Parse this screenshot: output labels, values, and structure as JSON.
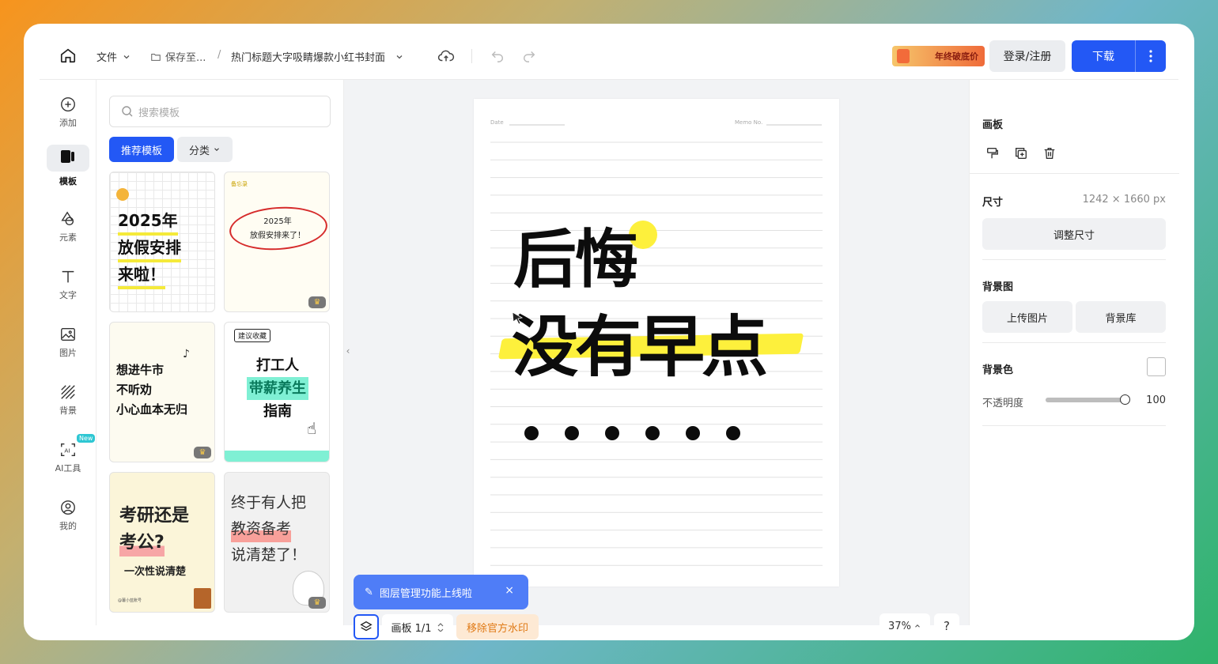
{
  "topbar": {
    "file_menu": "文件",
    "save_to": "保存至...",
    "breadcrumb_sep": "/",
    "doc_title": "热门标题大字吸睛爆款小红书封面",
    "promo_text": "年终破底价",
    "login": "登录/注册",
    "download": "下载"
  },
  "leftnav": {
    "items": [
      {
        "label": "添加",
        "icon": "plus-circle-icon"
      },
      {
        "label": "模板",
        "icon": "template-icon",
        "active": true
      },
      {
        "label": "元素",
        "icon": "shapes-icon"
      },
      {
        "label": "文字",
        "icon": "text-icon"
      },
      {
        "label": "图片",
        "icon": "image-icon"
      },
      {
        "label": "背景",
        "icon": "background-icon"
      },
      {
        "label": "AI工具",
        "icon": "ai-icon",
        "badge": "New"
      },
      {
        "label": "我的",
        "icon": "user-icon"
      }
    ]
  },
  "templates": {
    "search_placeholder": "搜索模板",
    "recommend": "推荐模板",
    "category": "分类",
    "cards": [
      {
        "lines": [
          "2025年",
          "放假安排",
          "来啦！"
        ]
      },
      {
        "header": "备忘录",
        "lines": [
          "2025年",
          "放假安排来了！"
        ]
      },
      {
        "lines": [
          "想进牛市",
          "不听劝",
          "小心血本无归"
        ]
      },
      {
        "tag": "建议收藏",
        "lines": [
          "打工人",
          "带薪养生",
          "指南"
        ]
      },
      {
        "lines": [
          "考研还是",
          "考公?",
          "一次性说清楚"
        ],
        "footer": "@薯小蓝账号"
      },
      {
        "lines": [
          "终于有人把",
          "教资备考",
          "说清楚了！"
        ]
      }
    ]
  },
  "canvas": {
    "date_label": "Date",
    "memo_label": "Memo No.",
    "headline_1": "后悔",
    "headline_2": "没有早点",
    "dots": 6
  },
  "bottom": {
    "tip_text": "图层管理功能上线啦",
    "tip_close": "×",
    "board_indicator": "画板 1/1",
    "remove_watermark": "移除官方水印",
    "zoom": "37%",
    "help": "?"
  },
  "rightpanel": {
    "board_title": "画板",
    "size_label": "尺寸",
    "size_value": "1242 × 1660 px",
    "resize_btn": "调整尺寸",
    "bg_image_title": "背景图",
    "upload_btn": "上传图片",
    "bg_library_btn": "背景库",
    "bg_color_title": "背景色",
    "opacity_label": "不透明度",
    "opacity_value": "100",
    "opacity_level": 1.0
  },
  "colors": {
    "primary": "#2358f5",
    "highlight_yellow": "#fdf03c",
    "tip_blue": "#4f7df7",
    "watermark_orange": "#e07a16"
  }
}
